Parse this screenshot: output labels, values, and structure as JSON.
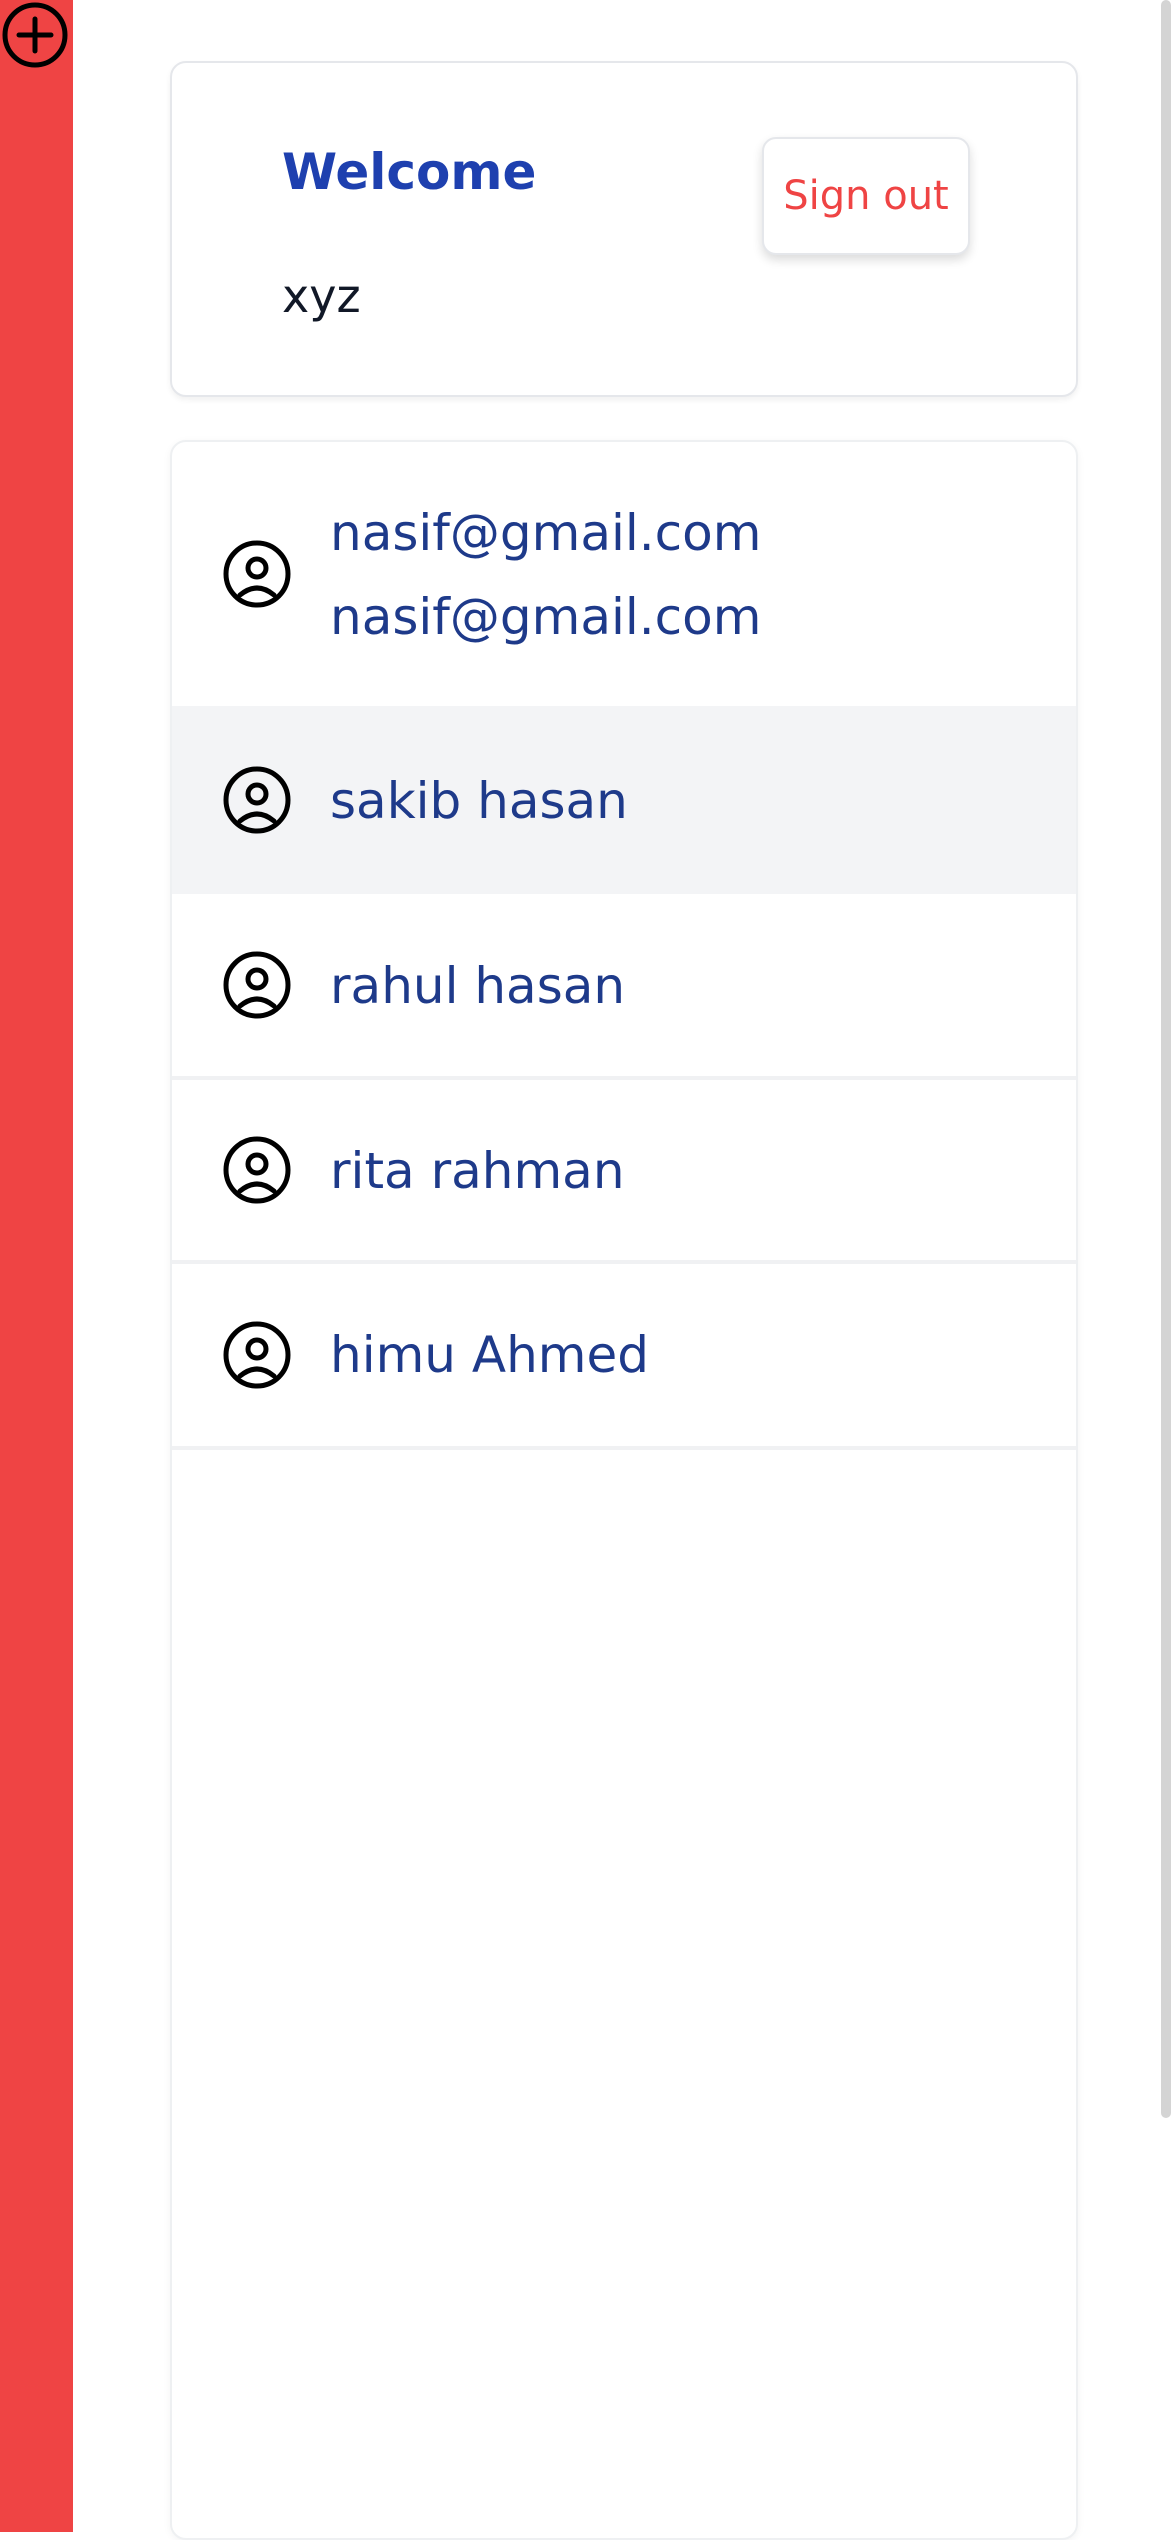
{
  "sidebar": {
    "add_icon": "plus-circle-icon",
    "accent_color": "#ef4444"
  },
  "header": {
    "welcome_label": "Welcome",
    "username": "xyz",
    "sign_out_label": "Sign out"
  },
  "contacts": [
    {
      "icon": "user-circle-icon",
      "name": "nasif@gmail.com",
      "subtitle": "nasif@gmail.com",
      "selected": false
    },
    {
      "icon": "user-circle-icon",
      "name": "sakib hasan",
      "selected": true
    },
    {
      "icon": "user-circle-icon",
      "name": "rahul hasan",
      "selected": false
    },
    {
      "icon": "user-circle-icon",
      "name": "rita rahman",
      "selected": false
    },
    {
      "icon": "user-circle-icon",
      "name": "himu Ahmed",
      "selected": false
    }
  ],
  "colors": {
    "title": "#1e40af",
    "contact_text": "#1e3a8a",
    "sign_out": "#ef4444",
    "selected_row": "#f3f4f6"
  }
}
